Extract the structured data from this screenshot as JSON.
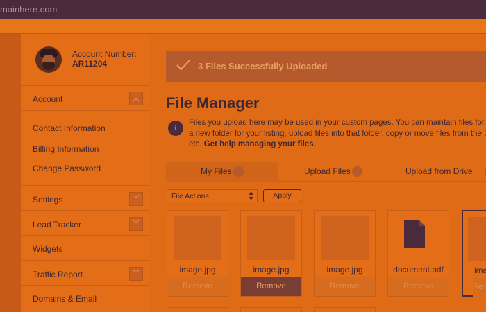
{
  "browser": {
    "url": "mainhere.com"
  },
  "profile": {
    "account_label": "Account Number:",
    "account_number": "AR11204"
  },
  "sidebar": {
    "account": "Account",
    "account_items": [
      "Contact Information",
      "Billing Information",
      "Change Password"
    ],
    "settings": "Settings",
    "lead_tracker": "Lead Tracker",
    "widgets": "Widgets",
    "traffic_report": "Traffic Report",
    "domains_email": "Domains & Email"
  },
  "alert": {
    "message": "3 Files Successfully Uploaded"
  },
  "main": {
    "title": "File Manager",
    "info_icon_glyph": "i",
    "desc_line1": "Files you upload here may be used in your custom pages. You can maintain files for e",
    "desc_line2": "a new folder for your listing, upload files into that folder, copy or move files from the U",
    "desc_line3_prefix": "etc. ",
    "desc_line3_link": "Get help managing your files."
  },
  "tabs": [
    "My Files",
    "Upload Files",
    "Upload from Drive"
  ],
  "toolbar": {
    "select_value": "File Actions",
    "apply_label": "Apply"
  },
  "files": [
    {
      "name": "image.jpg",
      "remove": "Remove"
    },
    {
      "name": "image.jpg",
      "remove": "Remove"
    },
    {
      "name": "image.jpg",
      "remove": "Remove"
    },
    {
      "name": "document.pdf",
      "remove": "Remove"
    },
    {
      "name": "ima",
      "remove": "Re"
    }
  ],
  "colors": {
    "accent": "#e06b17",
    "dark": "#4a2b3c",
    "alert_bg": "#b55a2c"
  },
  "icons": [
    "check-icon",
    "chevron-up-icon",
    "chevron-down-icon",
    "info-icon",
    "document-icon"
  ]
}
